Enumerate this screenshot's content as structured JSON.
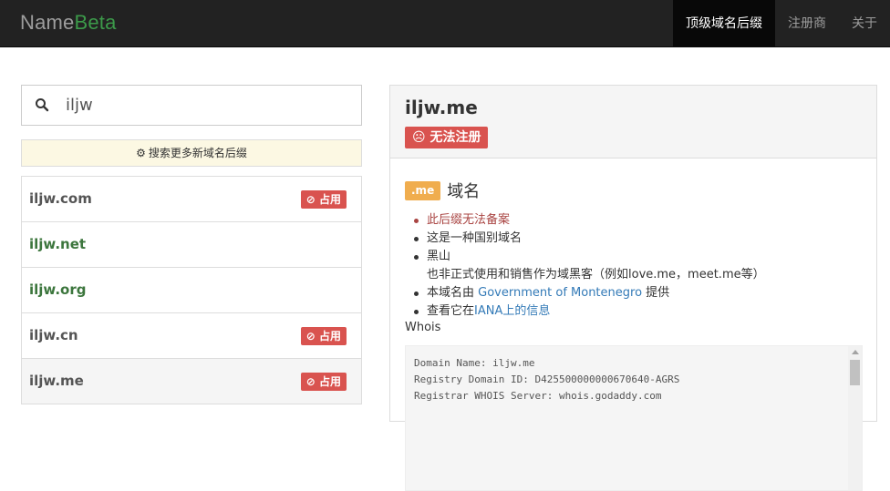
{
  "brand": {
    "name": "Name",
    "accent": "Beta"
  },
  "nav": {
    "items": [
      "顶级域名后缀",
      "注册商",
      "关于"
    ]
  },
  "search": {
    "value": "iljw",
    "placeholder": ""
  },
  "more_tlds_label": "搜索更多新域名后缀",
  "domains": [
    {
      "name": "iljw.com",
      "status": "占用",
      "taken": true
    },
    {
      "name": "iljw.net",
      "status": "",
      "taken": false
    },
    {
      "name": "iljw.org",
      "status": "",
      "taken": false
    },
    {
      "name": "iljw.cn",
      "status": "占用",
      "taken": true
    },
    {
      "name": "iljw.me",
      "status": "占用",
      "taken": true,
      "selected": true
    }
  ],
  "detail": {
    "title": "iljw.me",
    "status": "无法注册",
    "tld_tag": ".me",
    "tld_word": "域名",
    "facts": {
      "no_filing": "此后缀无法备案",
      "country_code": "这是一种国别域名",
      "region": "黑山",
      "hack_note": "也非正式使用和销售作为域黑客（例如love.me，meet.me等）",
      "provided_prefix": "本域名由",
      "provider": "Government of Montenegro",
      "provided_suffix": "提供",
      "iana_prefix": "查看它在",
      "iana_link": "IANA上的信息"
    },
    "whois_label": "Whois",
    "whois_lines": [
      "Domain Name: iljw.me",
      "Registry Domain ID: D425500000000670640-AGRS",
      "Registrar WHOIS Server: whois.godaddy.com"
    ]
  },
  "colors": {
    "navbar": "#222222",
    "brand_accent": "#3c9a4a",
    "danger": "#d9534f",
    "success_text": "#3c763d",
    "warning_tag": "#f0ad4e",
    "link": "#337ab7"
  }
}
